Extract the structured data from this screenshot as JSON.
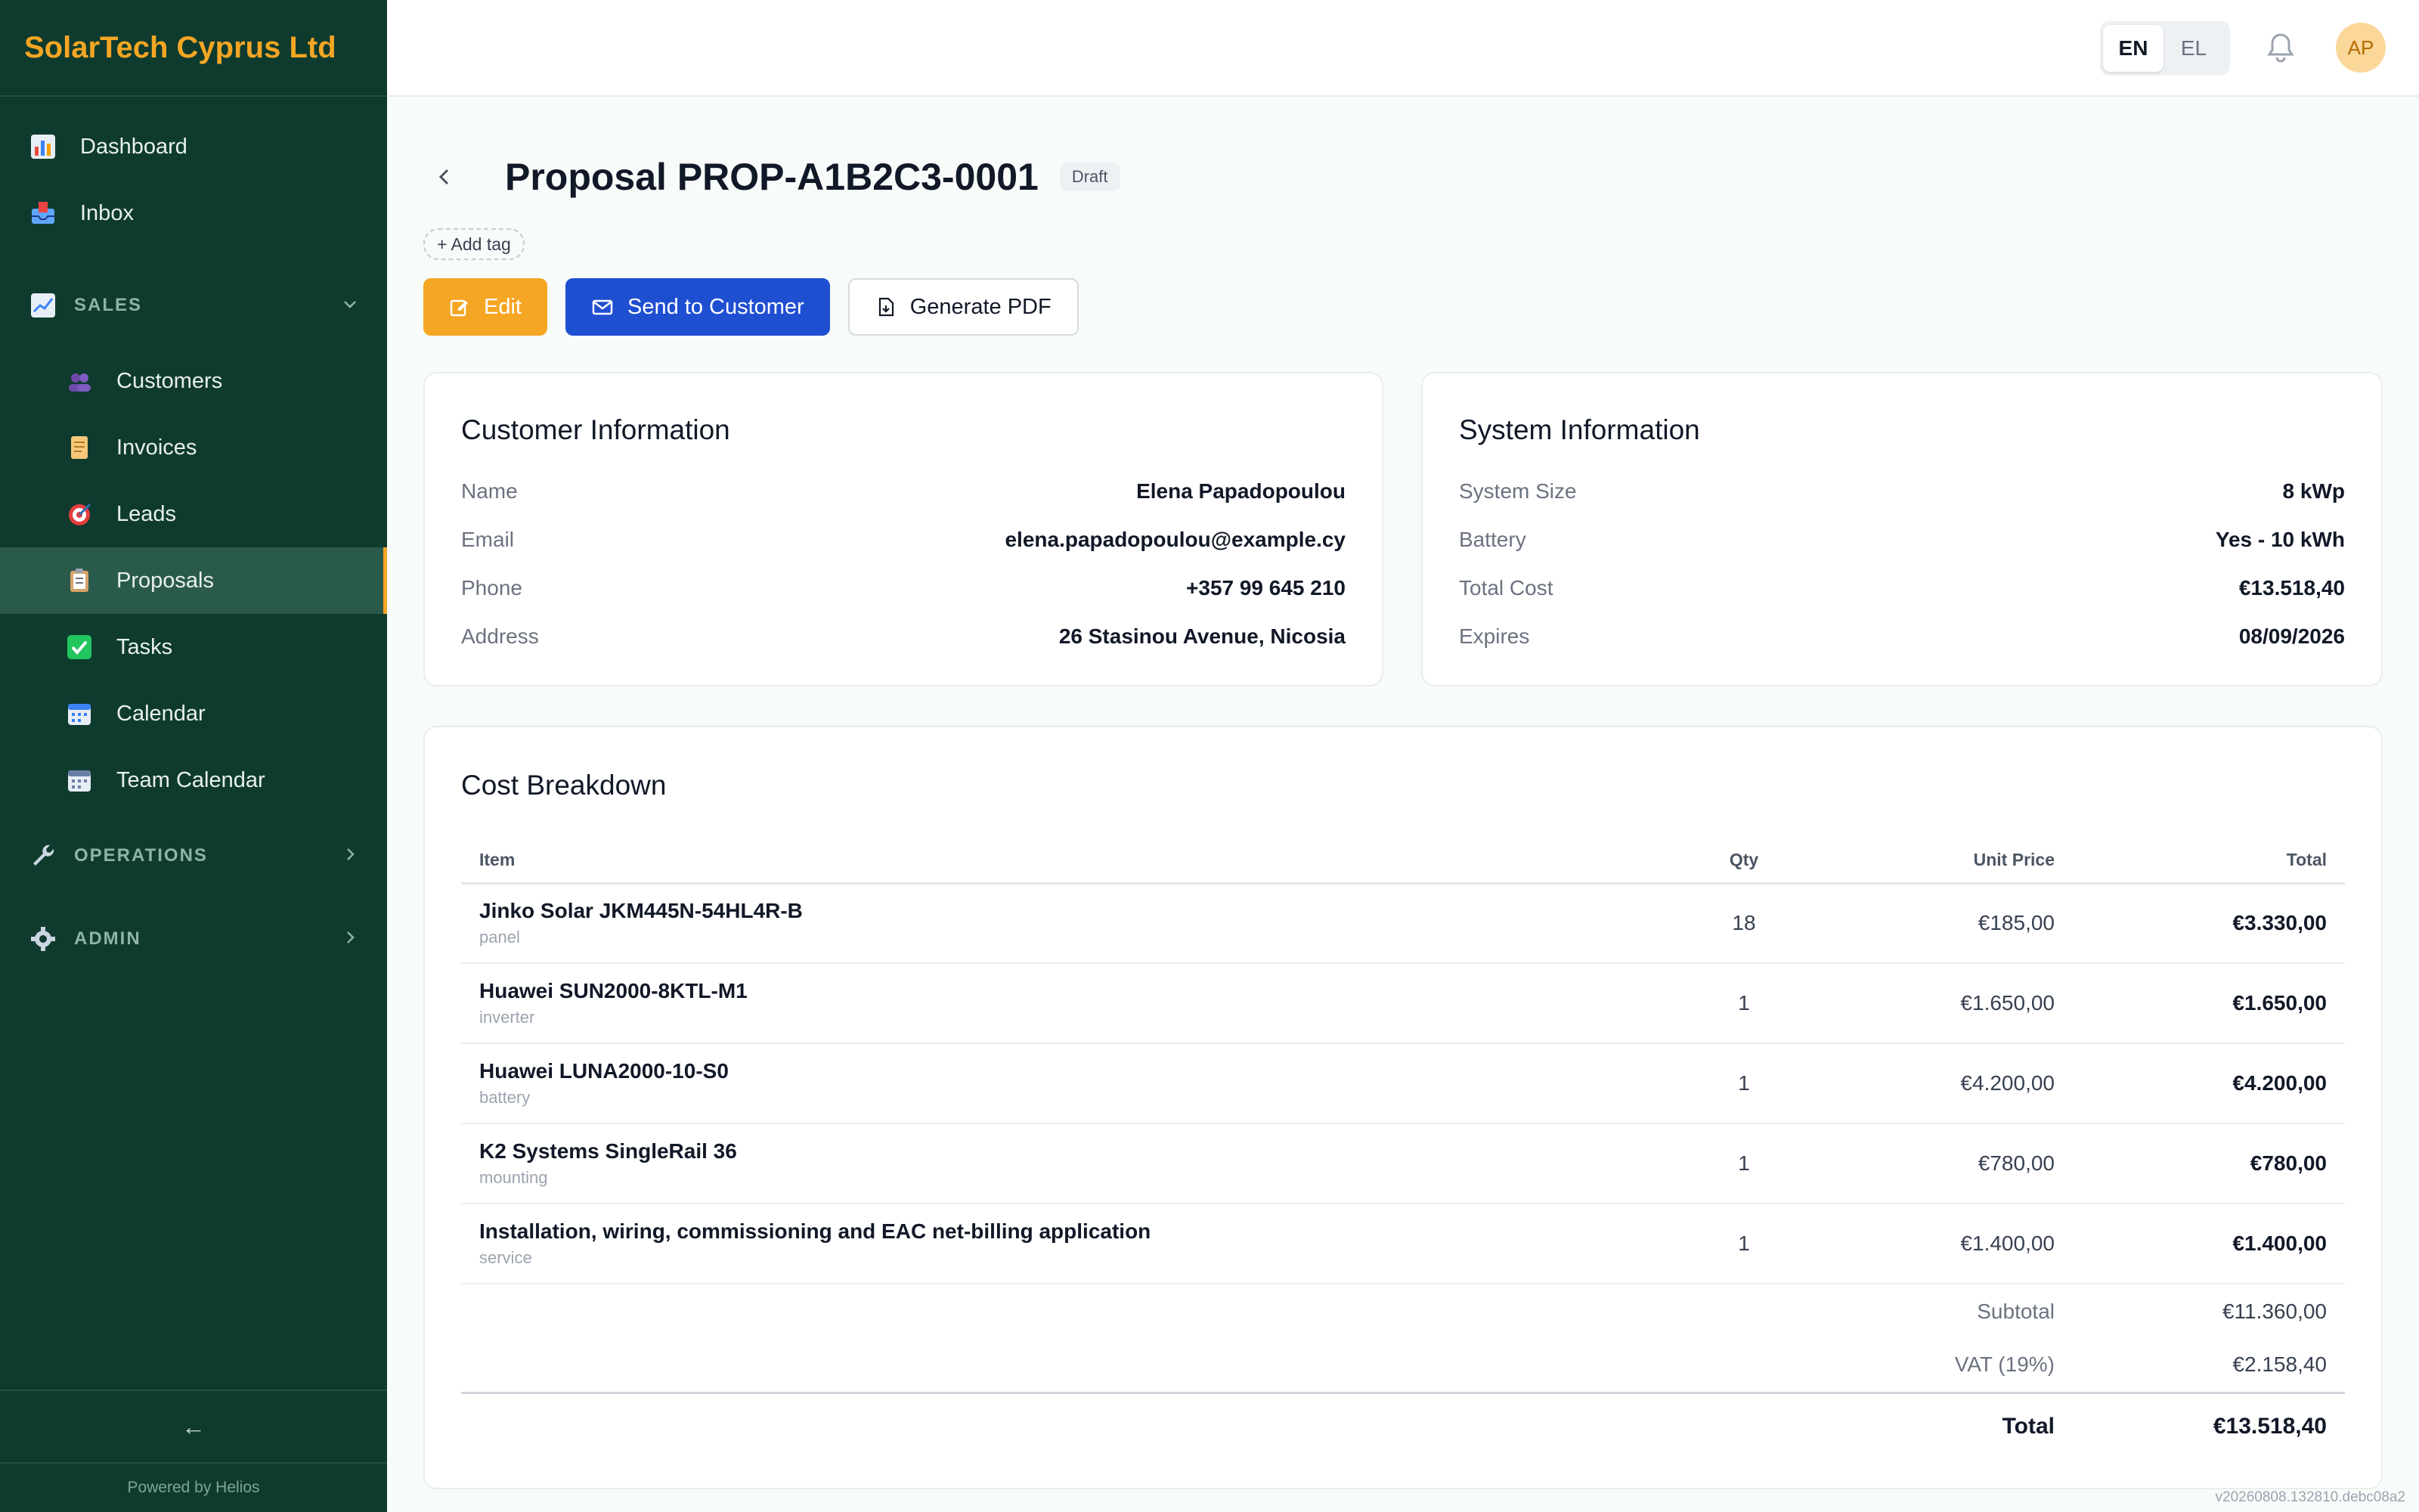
{
  "brand": "SolarTech Cyprus Ltd",
  "sidebar": {
    "top_items": [
      {
        "label": "Dashboard",
        "icon": "bar-chart-icon"
      },
      {
        "label": "Inbox",
        "icon": "inbox-icon"
      }
    ],
    "sales_section": {
      "label": "SALES",
      "expanded": true
    },
    "sales_items": [
      {
        "label": "Customers",
        "icon": "users-icon"
      },
      {
        "label": "Invoices",
        "icon": "scroll-icon"
      },
      {
        "label": "Leads",
        "icon": "target-icon"
      },
      {
        "label": "Proposals",
        "icon": "clipboard-icon",
        "active": true
      },
      {
        "label": "Tasks",
        "icon": "check-icon"
      },
      {
        "label": "Calendar",
        "icon": "calendar-icon"
      },
      {
        "label": "Team Calendar",
        "icon": "calendar-icon"
      }
    ],
    "operations_section": {
      "label": "OPERATIONS",
      "expanded": false
    },
    "admin_section": {
      "label": "ADMIN",
      "expanded": false
    },
    "collapse_label": "←",
    "powered_by": "Powered by Helios"
  },
  "topbar": {
    "lang_options": [
      "EN",
      "EL"
    ],
    "lang_selected": "EN",
    "avatar_initials": "AP"
  },
  "page": {
    "title": "Proposal PROP-A1B2C3-0001",
    "status_badge": "Draft",
    "add_tag": "+ Add tag",
    "buttons": {
      "edit": "Edit",
      "send": "Send to Customer",
      "pdf": "Generate PDF"
    }
  },
  "customer_info": {
    "heading": "Customer Information",
    "rows": [
      {
        "label": "Name",
        "value": "Elena Papadopoulou"
      },
      {
        "label": "Email",
        "value": "elena.papadopoulou@example.cy"
      },
      {
        "label": "Phone",
        "value": "+357 99 645 210"
      },
      {
        "label": "Address",
        "value": "26 Stasinou Avenue, Nicosia"
      }
    ]
  },
  "system_info": {
    "heading": "System Information",
    "rows": [
      {
        "label": "System Size",
        "value": "8 kWp"
      },
      {
        "label": "Battery",
        "value": "Yes - 10 kWh"
      },
      {
        "label": "Total Cost",
        "value": "€13.518,40"
      },
      {
        "label": "Expires",
        "value": "08/09/2026"
      }
    ]
  },
  "cost_breakdown": {
    "heading": "Cost Breakdown",
    "columns": [
      "Item",
      "Qty",
      "Unit Price",
      "Total"
    ],
    "rows": [
      {
        "name": "Jinko Solar JKM445N-54HL4R-B",
        "category": "panel",
        "qty": "18",
        "unit_price": "€185,00",
        "total": "€3.330,00"
      },
      {
        "name": "Huawei SUN2000-8KTL-M1",
        "category": "inverter",
        "qty": "1",
        "unit_price": "€1.650,00",
        "total": "€1.650,00"
      },
      {
        "name": "Huawei LUNA2000-10-S0",
        "category": "battery",
        "qty": "1",
        "unit_price": "€4.200,00",
        "total": "€4.200,00"
      },
      {
        "name": "K2 Systems SingleRail 36",
        "category": "mounting",
        "qty": "1",
        "unit_price": "€780,00",
        "total": "€780,00"
      },
      {
        "name": "Installation, wiring, commissioning and EAC net-billing application",
        "category": "service",
        "qty": "1",
        "unit_price": "€1.400,00",
        "total": "€1.400,00"
      }
    ],
    "subtotal_label": "Subtotal",
    "subtotal": "€11.360,00",
    "vat_label": "VAT (19%)",
    "vat": "€2.158,40",
    "total_label": "Total",
    "total": "€13.518,40"
  },
  "version": "v20260808.132810.debc08a2",
  "colors": {
    "sidebar_bg": "#0f3b2e",
    "brand_accent": "#f5a623",
    "primary_blue": "#1f4fd1"
  }
}
